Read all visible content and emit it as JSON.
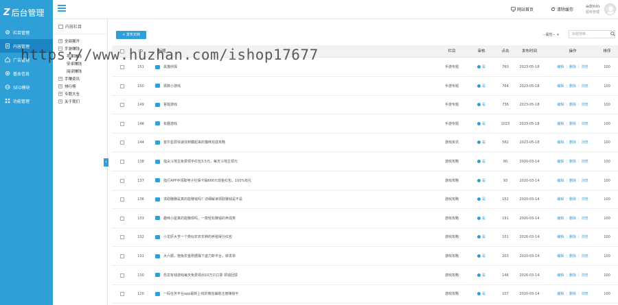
{
  "app": {
    "logo_text": "后台管理"
  },
  "nav": [
    {
      "label": "栏目管理",
      "icon": "gear-icon",
      "active": false
    },
    {
      "label": "内容管理",
      "icon": "document-icon",
      "active": true
    },
    {
      "label": "广告管理",
      "icon": "home-icon",
      "active": false
    },
    {
      "label": "基本信息",
      "icon": "settings-icon",
      "active": false
    },
    {
      "label": "SEO模块",
      "icon": "globe-icon",
      "active": false
    },
    {
      "label": "功能管理",
      "icon": "grid-icon",
      "active": false
    }
  ],
  "topbar": {
    "site_home": "网站首页",
    "clear_cache": "清除缓存",
    "user": "admin",
    "role": "超级管理"
  },
  "tree": {
    "title": "内容栏目",
    "items": [
      {
        "label": "全部展开",
        "sign": "+",
        "child": false
      },
      {
        "label": "手游赚钱",
        "sign": "−",
        "child": false
      },
      {
        "label": "苹果赚钱",
        "sign": "",
        "child": true
      },
      {
        "label": "安卓赚钱",
        "sign": "",
        "child": true
      },
      {
        "label": "阅读赚钱",
        "sign": "",
        "child": true
      },
      {
        "label": "手赚资讯",
        "sign": "+",
        "child": false
      },
      {
        "label": "排行榜",
        "sign": "+",
        "child": false
      },
      {
        "label": "专题大全",
        "sign": "+",
        "child": false
      },
      {
        "label": "关于我们",
        "sign": "+",
        "child": false
      }
    ]
  },
  "toolbar": {
    "add_label": "+ 发布文档",
    "attr_select": "--属性--",
    "search_placeholder": "标题搜索..."
  },
  "table": {
    "headers": {
      "id": "ID",
      "title": "标题",
      "column": "栏目",
      "audit": "审核",
      "views": "点击",
      "time": "发布时间",
      "ops": "操作",
      "sort": "排序"
    },
    "rows": [
      {
        "id": "151",
        "title": "黑猫侦探",
        "column": "手游专题",
        "audit": "是",
        "views": "760",
        "time": "2023-05-18",
        "sort": "100"
      },
      {
        "id": "150",
        "title": "猜数小游戏",
        "column": "手游专题",
        "audit": "是",
        "views": "764",
        "time": "2023-05-18",
        "sort": "100"
      },
      {
        "id": "149",
        "title": "答题游戏",
        "column": "手游专题",
        "audit": "是",
        "views": "736",
        "time": "2023-05-18",
        "sort": "100"
      },
      {
        "id": "148",
        "title": "有趣游戏",
        "column": "手游专题",
        "audit": "是",
        "views": "1023",
        "time": "2023-05-18",
        "sort": "100"
      },
      {
        "id": "144",
        "title": "首尔星辰快速找到藏起来的猫咪完成攻略",
        "column": "游戏资讯",
        "audit": "是",
        "views": "582",
        "time": "2023-05-18",
        "sort": "100"
      },
      {
        "id": "138",
        "title": "指尖斗地主免费领手红包3.5元，每天斗地主领元",
        "column": "游戏攻略",
        "audit": "是",
        "views": "80",
        "time": "2020-03-14",
        "sort": "100"
      },
      {
        "id": "137",
        "title": "指行APP中领取电子社保卡抽666元现金红包，100%有礼",
        "column": "游戏攻略",
        "audit": "是",
        "views": "93",
        "time": "2020-03-14",
        "sort": "100"
      },
      {
        "id": "136",
        "title": "求助赚赚是真的能赚钱吗？详细解读领取赚钱是不是",
        "column": "游戏攻略",
        "audit": "是",
        "views": "152",
        "time": "2020-03-14",
        "sort": "100"
      },
      {
        "id": "133",
        "title": "趣味小屋真的能赚现吗，一款轻松赚钱的养成类",
        "column": "游戏攻略",
        "audit": "是",
        "views": "191",
        "time": "2020-03-14",
        "sort": "100"
      },
      {
        "id": "132",
        "title": "小龙虾大亨一个类似农农农种的养殖得分红包",
        "column": "游戏攻略",
        "audit": "是",
        "views": "101",
        "time": "2020-03-14",
        "sort": "100"
      },
      {
        "id": "131",
        "title": "大六顺，抱兔农金刚据摆下盗力新平台，转发单",
        "column": "游戏攻略",
        "audit": "是",
        "views": "203",
        "time": "2020-03-14",
        "sort": "100"
      },
      {
        "id": "130",
        "title": "恐龙有钱游戏每天免费领出10万只口罩 领钱回馈",
        "column": "游戏攻略",
        "audit": "是",
        "views": "146",
        "time": "2020-03-14",
        "sort": "100"
      },
      {
        "id": "120",
        "title": "一码任务平台app最新上线的微信辅助注册赚钱平",
        "column": "游戏攻略",
        "audit": "是",
        "views": "107",
        "time": "2020-03-14",
        "sort": "100"
      }
    ],
    "ops": {
      "edit": "编辑",
      "delete": "删除",
      "preview": "浏览"
    }
  },
  "watermark": "https://www.huzhan.com/ishop17677"
}
